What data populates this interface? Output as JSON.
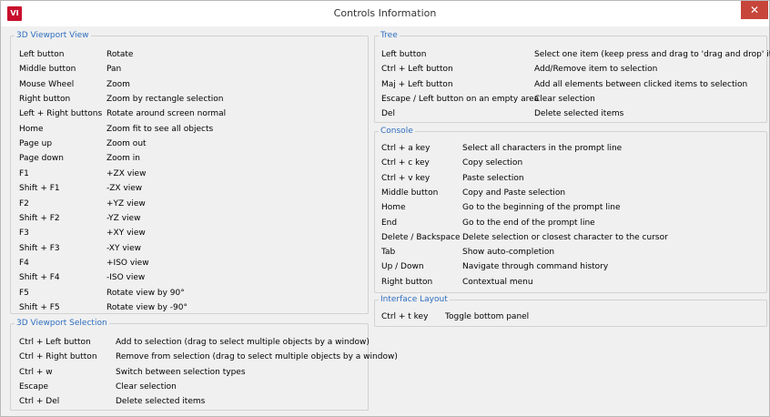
{
  "window": {
    "title": "Controls Information",
    "app_icon_text": "VI",
    "close_symbol": "✕"
  },
  "viewport_view": {
    "title": "3D Viewport View",
    "rows": [
      {
        "key": "Left button",
        "desc": "Rotate"
      },
      {
        "key": "Middle button",
        "desc": "Pan"
      },
      {
        "key": "Mouse Wheel",
        "desc": "Zoom"
      },
      {
        "key": "Right button",
        "desc": "Zoom  by rectangle selection"
      },
      {
        "key": "Left + Right buttons",
        "desc": "Rotate around screen normal"
      },
      {
        "key": "Home",
        "desc": "Zoom fit to see all objects"
      },
      {
        "key": "Page up",
        "desc": "Zoom out"
      },
      {
        "key": "Page down",
        "desc": "Zoom in"
      },
      {
        "key": "F1",
        "desc": "+ZX view"
      },
      {
        "key": "Shift + F1",
        "desc": "-ZX view"
      },
      {
        "key": "F2",
        "desc": "+YZ view"
      },
      {
        "key": "Shift + F2",
        "desc": "-YZ view"
      },
      {
        "key": "F3",
        "desc": "+XY view"
      },
      {
        "key": "Shift + F3",
        "desc": "-XY view"
      },
      {
        "key": "F4",
        "desc": "+ISO view"
      },
      {
        "key": "Shift + F4",
        "desc": "-ISO view"
      },
      {
        "key": "F5",
        "desc": "Rotate view by 90°"
      },
      {
        "key": "Shift + F5",
        "desc": "Rotate view by -90°"
      }
    ]
  },
  "viewport_selection": {
    "title": "3D Viewport Selection",
    "rows": [
      {
        "key": "Ctrl + Left button",
        "desc": "Add to selection (drag to select multiple objects by a window)"
      },
      {
        "key": "Ctrl + Right button",
        "desc": "Remove from selection (drag to select multiple objects by a window)"
      },
      {
        "key": "Ctrl + w",
        "desc": "Switch between selection types"
      },
      {
        "key": "Escape",
        "desc": "Clear selection"
      },
      {
        "key": "Ctrl + Del",
        "desc": "Delete selected items"
      }
    ]
  },
  "tree": {
    "title": "Tree",
    "rows": [
      {
        "key": "Left button",
        "desc": "Select one item (keep press and drag to 'drag and drop' item)"
      },
      {
        "key": "Ctrl + Left button",
        "desc": "Add/Remove item to selection"
      },
      {
        "key": "Maj + Left button",
        "desc": "Add all elements between clicked items to selection"
      },
      {
        "key": "Escape / Left button on an empty area",
        "desc": "Clear selection"
      },
      {
        "key": "Del",
        "desc": "Delete selected items"
      }
    ]
  },
  "console": {
    "title": "Console",
    "rows": [
      {
        "key": "Ctrl + a key",
        "desc": "Select all characters in the prompt line"
      },
      {
        "key": "Ctrl + c key",
        "desc": "Copy selection"
      },
      {
        "key": "Ctrl + v key",
        "desc": "Paste selection"
      },
      {
        "key": "Middle button",
        "desc": "Copy and Paste selection"
      },
      {
        "key": "Home",
        "desc": "Go to the beginning of the prompt line"
      },
      {
        "key": "End",
        "desc": "Go to the end of the prompt line"
      },
      {
        "key": "Delete / Backspace",
        "desc": "Delete selection or closest character to the cursor"
      },
      {
        "key": "Tab",
        "desc": "Show auto-completion"
      },
      {
        "key": "Up / Down",
        "desc": "Navigate through command history"
      },
      {
        "key": "Right button",
        "desc": "Contextual menu"
      }
    ]
  },
  "interface_layout": {
    "title": "Interface Layout",
    "rows": [
      {
        "key": "Ctrl + t key",
        "desc": "Toggle bottom panel"
      }
    ]
  }
}
